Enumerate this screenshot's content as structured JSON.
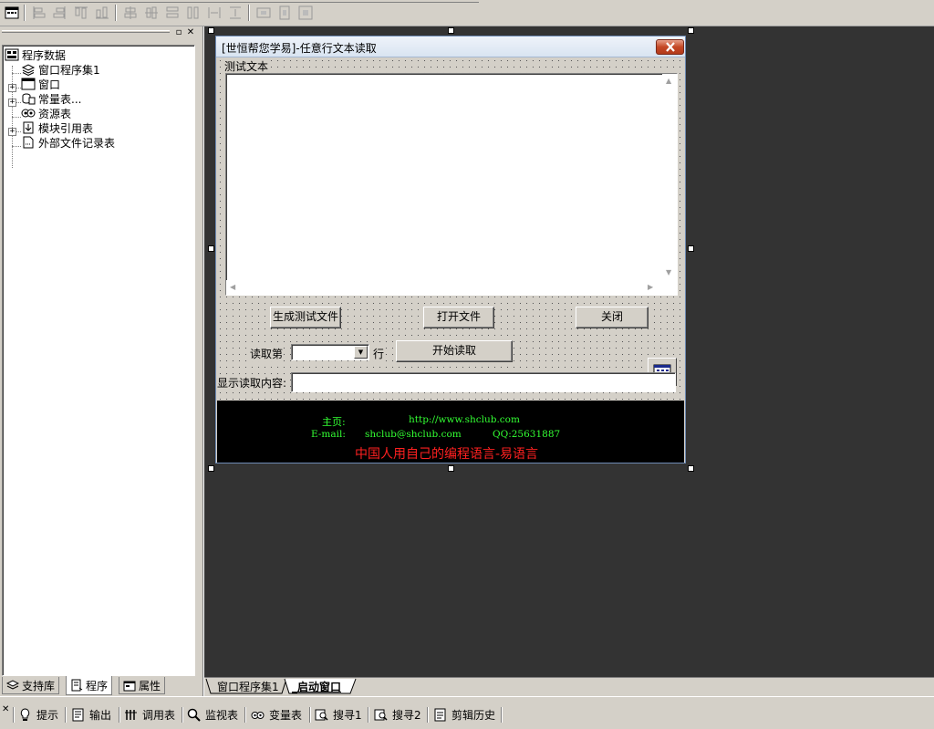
{
  "left_panel": {
    "tree": {
      "root": "程序数据",
      "items": [
        "窗口程序集1",
        "窗口",
        "常量表...",
        "资源表",
        "模块引用表",
        "外部文件记录表"
      ]
    },
    "tabs": [
      "支持库",
      "程序",
      "属性"
    ]
  },
  "designer": {
    "window_title": "[世恒帮您学易]-任意行文本读取",
    "test_text_label": "测试文本",
    "buttons": {
      "generate": "生成测试文件",
      "open": "打开文件",
      "close": "关闭",
      "start": "开始读取"
    },
    "read_prefix": "读取第",
    "read_suffix": "行",
    "combo_value": "",
    "show_label": "显示读取内容:",
    "result_value": "",
    "info": {
      "home_label": "主页:",
      "home_url": "http://www.shclub.com",
      "email_label": "E-mail:",
      "email": "shclub@shclub.com",
      "qq": "QQ:25631887",
      "slogan": "中国人用自己的编程语言-易语言"
    },
    "colors": {
      "info_green": "#33ff33",
      "info_red": "#ff2020"
    }
  },
  "doc_tabs": [
    "窗口程序集1",
    "_启动窗口"
  ],
  "bottom_bar": [
    "提示",
    "输出",
    "调用表",
    "监视表",
    "变量表",
    "搜寻1",
    "搜寻2",
    "剪辑历史"
  ]
}
